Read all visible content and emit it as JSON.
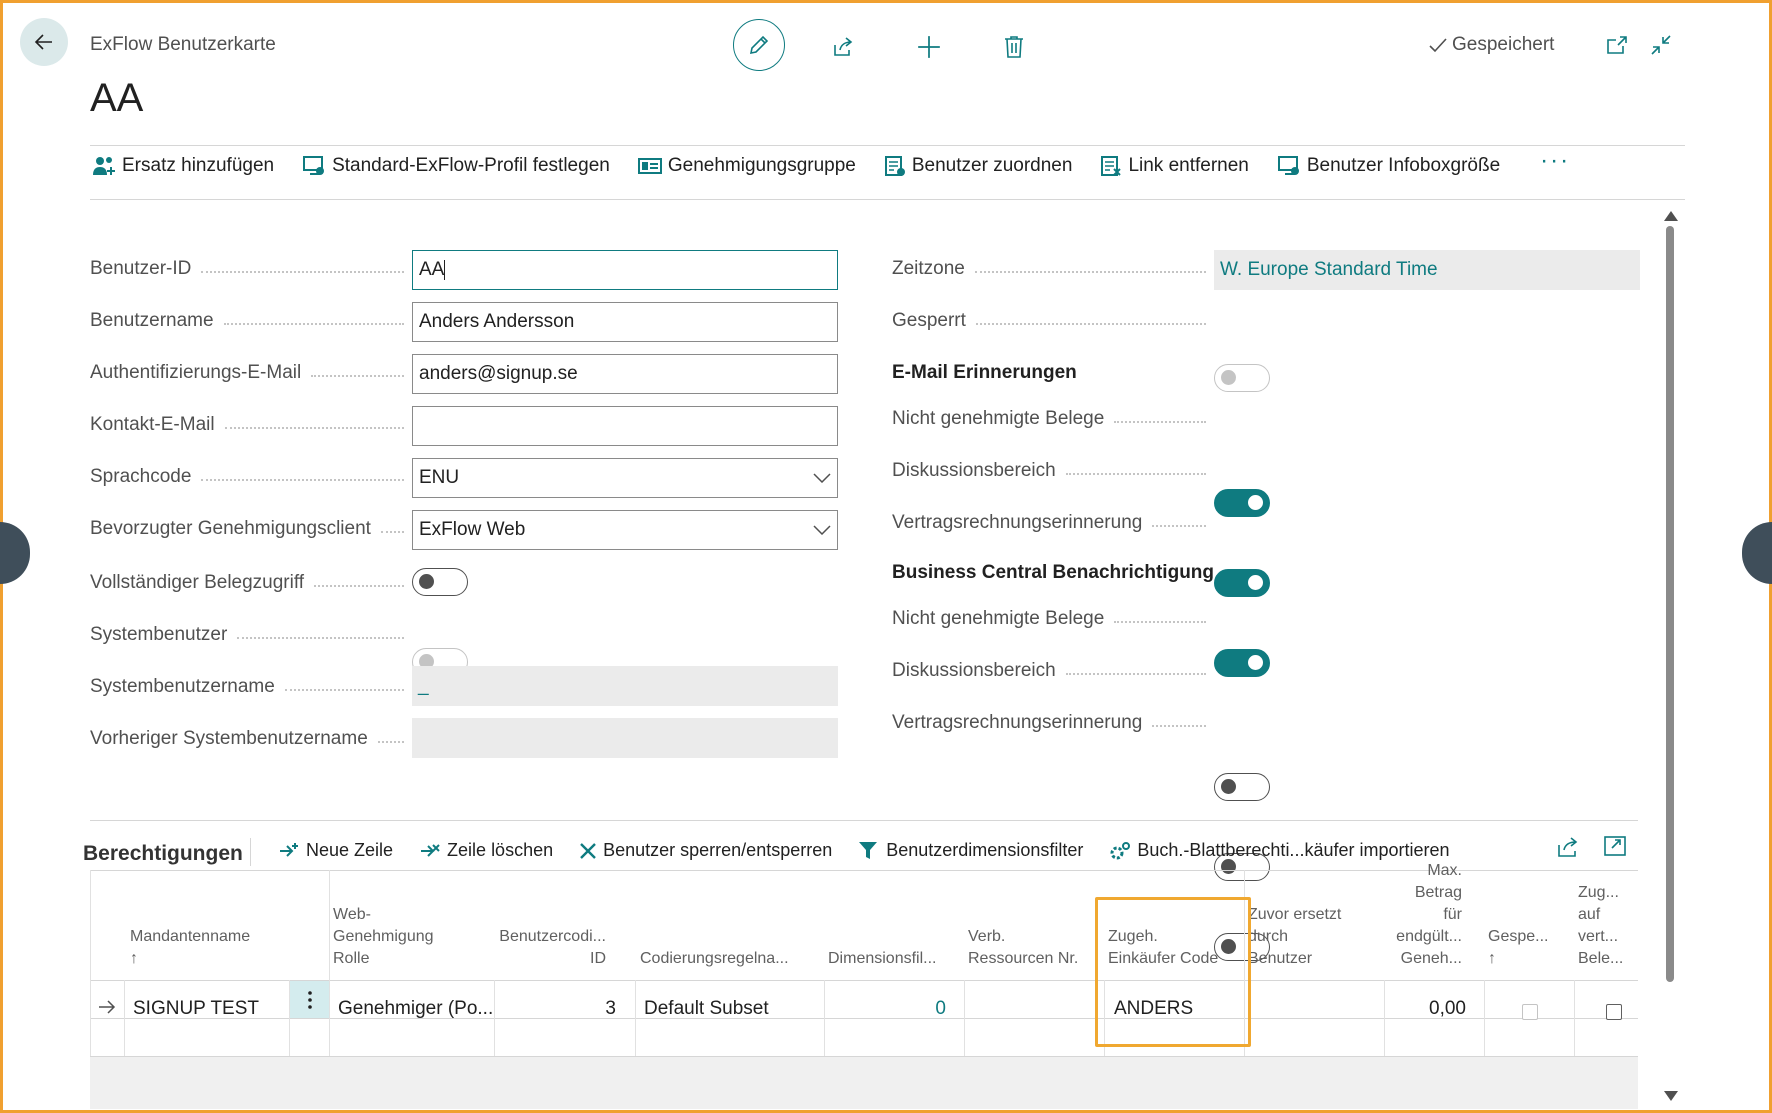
{
  "header": {
    "caption": "ExFlow Benutzerkarte",
    "title": "AA",
    "saved_label": "Gespeichert"
  },
  "actions": [
    {
      "label": "Ersatz hinzufügen",
      "icon": "add-substitute-icon"
    },
    {
      "label": "Standard-ExFlow-Profil festlegen",
      "icon": "profile-icon"
    },
    {
      "label": "Genehmigungsgruppe",
      "icon": "group-card-icon"
    },
    {
      "label": "Benutzer zuordnen",
      "icon": "assign-user-icon"
    },
    {
      "label": "Link entfernen",
      "icon": "remove-link-icon"
    },
    {
      "label": "Benutzer Infoboxgröße",
      "icon": "infobox-icon"
    }
  ],
  "more_label": "···",
  "fields_left": {
    "user_id": {
      "label": "Benutzer-ID",
      "value": "AA"
    },
    "user_name": {
      "label": "Benutzername",
      "value": "Anders Andersson"
    },
    "auth_email": {
      "label": "Authentifizierungs-E-Mail",
      "value": "anders@signup.se"
    },
    "contact_email": {
      "label": "Kontakt-E-Mail",
      "value": ""
    },
    "language_code": {
      "label": "Sprachcode",
      "value": "ENU"
    },
    "preferred_client": {
      "label": "Bevorzugter Genehmigungsclient",
      "value": "ExFlow Web"
    },
    "full_access": {
      "label": "Vollständiger Belegzugriff",
      "value": false
    },
    "system_user": {
      "label": "Systembenutzer",
      "value": false
    },
    "system_user_name": {
      "label": "Systembenutzername",
      "value": "_"
    },
    "previous_system_user_name": {
      "label": "Vorheriger Systembenutzername",
      "value": ""
    }
  },
  "fields_right": {
    "timezone": {
      "label": "Zeitzone",
      "value": "W. Europe Standard Time"
    },
    "blocked": {
      "label": "Gesperrt",
      "value": false
    },
    "email_heading": "E-Mail Erinnerungen",
    "email_unapproved": {
      "label": "Nicht genehmigte Belege",
      "value": true
    },
    "email_discussion": {
      "label": "Diskussionsbereich",
      "value": true
    },
    "email_contract": {
      "label": "Vertragsrechnungserinnerung",
      "value": true
    },
    "bc_heading": "Business Central Benachrichtigung",
    "bc_unapproved": {
      "label": "Nicht genehmigte Belege",
      "value": false
    },
    "bc_discussion": {
      "label": "Diskussionsbereich",
      "value": false
    },
    "bc_contract": {
      "label": "Vertragsrechnungserinnerung",
      "value": false
    }
  },
  "subpage": {
    "title": "Berechtigungen",
    "actions": [
      {
        "label": "Neue Zeile",
        "icon": "new-line-icon"
      },
      {
        "label": "Zeile löschen",
        "icon": "delete-line-icon"
      },
      {
        "label": "Benutzer sperren/entsperren",
        "icon": "block-user-icon"
      },
      {
        "label": "Benutzerdimensionsfilter",
        "icon": "filter-icon"
      },
      {
        "label": "Buch.-Blattberechti...käufer importieren",
        "icon": "import-icon"
      }
    ],
    "columns": [
      {
        "line1": "",
        "line2": "Mandantenname",
        "line3": "↑"
      },
      {
        "line1": "Web-",
        "line2": "Genehmigung",
        "line3": "Rolle"
      },
      {
        "line1": "",
        "line2": "Benutzercodi...",
        "line3": "ID"
      },
      {
        "line1": "",
        "line2": "",
        "line3": "Codierungsregelna..."
      },
      {
        "line1": "",
        "line2": "",
        "line3": "Dimensionsfil..."
      },
      {
        "line1": "",
        "line2": "Verb.",
        "line3": "Ressourcen Nr."
      },
      {
        "line1": "",
        "line2": "Zugeh.",
        "line3": "Einkäufer Code"
      },
      {
        "line1": "Zuvor ersetzt",
        "line2": "durch",
        "line3": "Benutzer"
      },
      {
        "line0": "Max.",
        "line0b": "Betrag",
        "line1": "für",
        "line2": "endgült...",
        "line3": "Geneh..."
      },
      {
        "line1": "",
        "line2": "Gespe...",
        "line3": "↑"
      },
      {
        "line0b": "Zug...",
        "line1": "auf",
        "line2": "vert...",
        "line3": "Bele..."
      }
    ],
    "rows": [
      {
        "company": "SIGNUP TEST",
        "role": "Genehmiger (Po...",
        "coding_id": "3",
        "coding_rule": "Default Subset",
        "dim_filter": "0",
        "resource_no": "",
        "purchaser_code": "ANDERS",
        "replaced_by": "",
        "max_amount": "0,00",
        "blocked": false,
        "contract_access": false
      }
    ]
  }
}
